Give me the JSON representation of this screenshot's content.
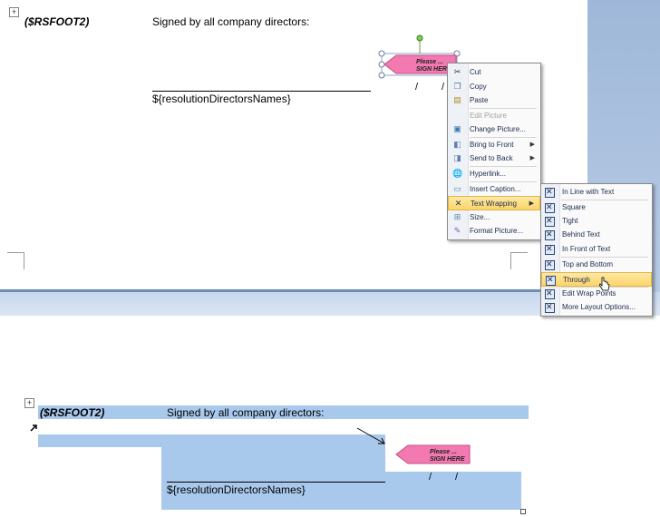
{
  "top_document": {
    "footer_code": "($RSFOOT2)",
    "signed_text": "Signed by all company directors:",
    "directors_names": "${resolutionDirectorsNames}",
    "slash": "/",
    "sign_label_line1": "Please ...",
    "sign_label_line2": "SIGN HERE"
  },
  "context_menu": {
    "items": [
      {
        "label": "Cut",
        "icon": "scissors-icon",
        "enabled": true
      },
      {
        "label": "Copy",
        "icon": "copy-icon",
        "enabled": true
      },
      {
        "label": "Paste",
        "icon": "paste-icon",
        "enabled": true
      },
      {
        "label": "Edit Picture",
        "icon": "",
        "enabled": false
      },
      {
        "label": "Change Picture...",
        "icon": "change-picture-icon",
        "enabled": true
      },
      {
        "label": "Bring to Front",
        "icon": "bring-front-icon",
        "enabled": true,
        "submenu": true
      },
      {
        "label": "Send to Back",
        "icon": "send-back-icon",
        "enabled": true,
        "submenu": true
      },
      {
        "label": "Hyperlink...",
        "icon": "hyperlink-icon",
        "enabled": true
      },
      {
        "label": "Insert Caption...",
        "icon": "caption-icon",
        "enabled": true
      },
      {
        "label": "Text Wrapping",
        "icon": "text-wrapping-icon",
        "enabled": true,
        "submenu": true,
        "highlighted": true
      },
      {
        "label": "Size...",
        "icon": "size-icon",
        "enabled": true
      },
      {
        "label": "Format Picture...",
        "icon": "format-picture-icon",
        "enabled": true
      }
    ]
  },
  "wrap_submenu": {
    "items": [
      {
        "label": "In Line with Text"
      },
      {
        "label": "Square"
      },
      {
        "label": "Tight"
      },
      {
        "label": "Behind Text"
      },
      {
        "label": "In Front of Text"
      },
      {
        "label": "Top and Bottom"
      },
      {
        "label": "Through",
        "highlighted": true
      },
      {
        "label": "Edit Wrap Points"
      },
      {
        "label": "More Layout Options..."
      }
    ]
  },
  "bottom_document": {
    "footer_code": "($RSFOOT2)",
    "signed_text": "Signed by all company directors:",
    "directors_names": "${resolutionDirectorsNames}",
    "slash": "/",
    "sign_label_line1": "Please ...",
    "sign_label_line2": "SIGN HERE"
  },
  "colors": {
    "selection_blue": "#a8c8ec",
    "menu_highlight": "#fbd46a",
    "sign_pink": "#f27ab0"
  }
}
